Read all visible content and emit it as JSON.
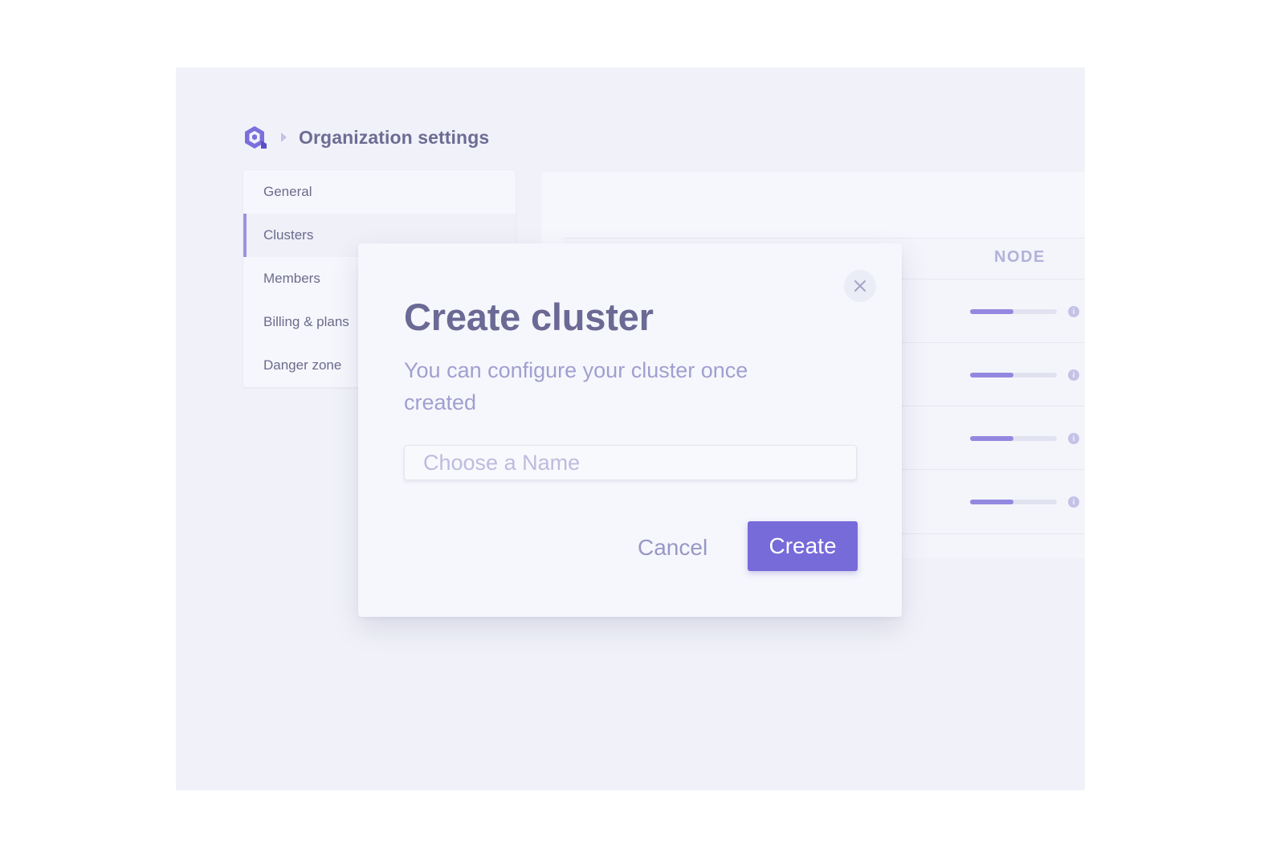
{
  "breadcrumb": {
    "logo_icon": "hexagon-logo-icon",
    "separator_icon": "caret-right-icon",
    "title": "Organization settings"
  },
  "sidebar": {
    "items": [
      {
        "label": "General",
        "active": false
      },
      {
        "label": "Clusters",
        "active": true
      },
      {
        "label": "Members",
        "active": false
      },
      {
        "label": "Billing & plans",
        "active": false
      },
      {
        "label": "Danger zone",
        "active": false
      }
    ]
  },
  "table": {
    "column_header": "NODE",
    "rows": [
      {
        "usage_fraction": 0.5
      },
      {
        "usage_fraction": 0.5
      },
      {
        "usage_fraction": 0.5
      },
      {
        "usage_fraction": 0.5
      }
    ]
  },
  "modal": {
    "title": "Create cluster",
    "description": "You can configure your cluster once created",
    "input": {
      "placeholder": "Choose a Name",
      "value": ""
    },
    "cancel_label": "Cancel",
    "create_label": "Create",
    "close_icon": "close-icon"
  },
  "colors": {
    "accent": "#776ad9",
    "background": "#f1f2f9",
    "title_text": "#6b6a95",
    "muted_text": "#a19fcf"
  }
}
